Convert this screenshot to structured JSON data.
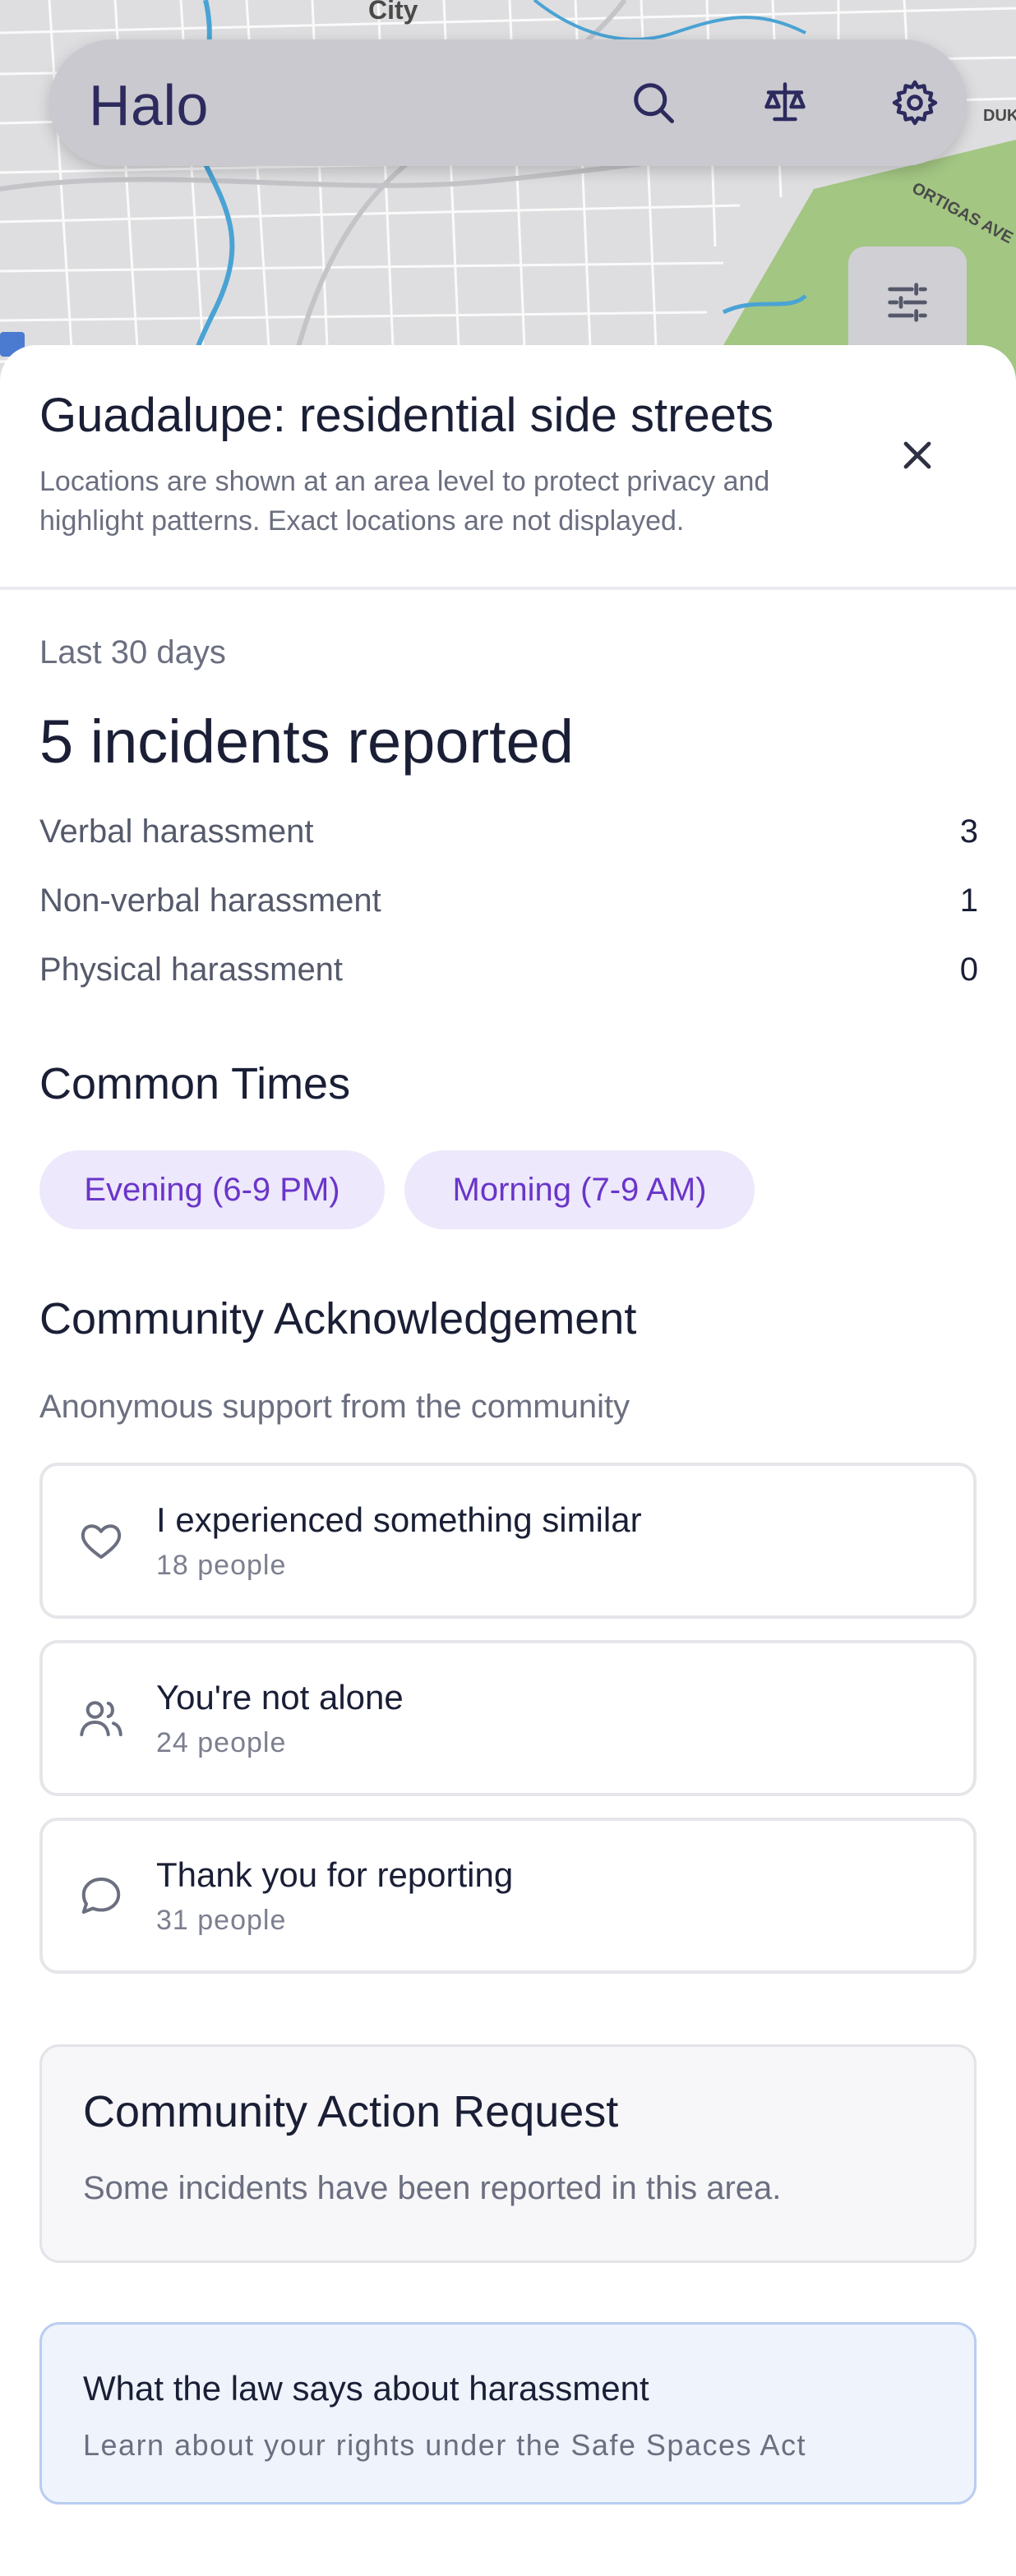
{
  "map": {
    "labels": {
      "city": "City",
      "duk": "DUK",
      "ortigas": "ORTIGAS AVE"
    }
  },
  "header": {
    "app_title": "Halo",
    "icons": [
      "search-icon",
      "scale-icon",
      "gear-icon"
    ],
    "filter_icon": "sliders-icon"
  },
  "sheet": {
    "title": "Guadalupe: residential side streets",
    "subtitle": "Locations are shown at an area level to protect privacy and highlight patterns. Exact locations are not displayed.",
    "close_icon": "close-icon",
    "period": "Last 30 days",
    "headline": "5 incidents reported",
    "stats": [
      {
        "label": "Verbal harassment",
        "value": "3"
      },
      {
        "label": "Non-verbal harassment",
        "value": "1"
      },
      {
        "label": "Physical harassment",
        "value": "0"
      }
    ],
    "common_times": {
      "heading": "Common Times",
      "chips": [
        "Evening (6-9 PM)",
        "Morning (7-9 AM)"
      ]
    },
    "acknowledgement": {
      "heading": "Community Acknowledgement",
      "subheading": "Anonymous support from the community",
      "items": [
        {
          "icon": "heart-icon",
          "label": "I experienced something similar",
          "count": "18 people"
        },
        {
          "icon": "people-icon",
          "label": "You're not alone",
          "count": "24 people"
        },
        {
          "icon": "chat-bubble-icon",
          "label": "Thank you for reporting",
          "count": "31 people"
        }
      ]
    },
    "action_request": {
      "heading": "Community Action Request",
      "text": "Some incidents have been reported in this area."
    },
    "law": {
      "heading": "What the law says about harassment",
      "text": "Learn about your rights under the Safe Spaces Act"
    }
  },
  "colors": {
    "accent_purple": "#6a35c9",
    "chip_bg": "#ede8fb",
    "map_green": "#9bc17a",
    "map_river": "#4aa3d4",
    "law_bg": "#eef3fc"
  }
}
